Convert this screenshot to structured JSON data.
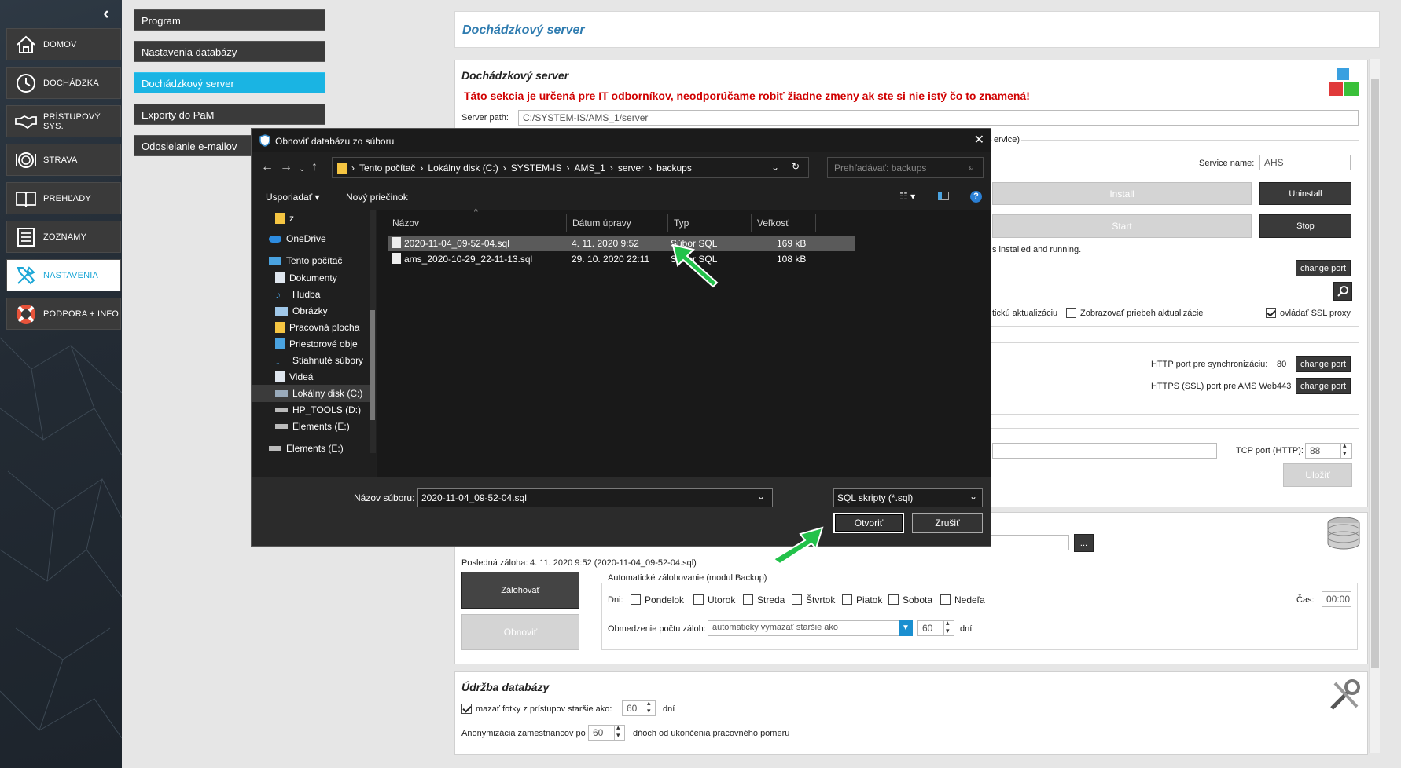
{
  "sidebar": {
    "items": [
      {
        "label": "DOMOV",
        "icon": "home-icon"
      },
      {
        "label": "DOCHÁDZKA",
        "icon": "clock-icon"
      },
      {
        "label": "PRÍSTUPOVÝ SYS.",
        "icon": "handshake-icon"
      },
      {
        "label": "STRAVA",
        "icon": "plate-icon"
      },
      {
        "label": "PREHĽADY",
        "icon": "book-icon"
      },
      {
        "label": "ZOZNAMY",
        "icon": "list-icon"
      },
      {
        "label": "NASTAVENIA",
        "icon": "tools-icon"
      },
      {
        "label": "PODPORA + INFO",
        "icon": "lifebuoy-icon"
      }
    ],
    "active": "NASTAVENIA"
  },
  "submenu": {
    "items": [
      "Program",
      "Nastavenia databázy",
      "Dochádzkový server",
      "Exporty do PaM",
      "Odosielanie e-mailov"
    ],
    "active": "Dochádzkový server"
  },
  "page": {
    "title": "Dochádzkový server"
  },
  "server_section": {
    "title": "Dochádzkový server",
    "warning": "Táto sekcia je určená pre IT odborníkov, neodporúčame robiť žiadne zmeny ak ste si nie istý čo to znamená!",
    "server_path_label": "Server path:",
    "server_path_value": "C:/SYSTEM-IS/AMS_1/server",
    "service_box_title_fragment": "ervice)",
    "service_name_label": "Service name:",
    "service_name_value": "AHS",
    "install_label": "Install",
    "uninstall_label": "Uninstall",
    "start_label": "Start",
    "stop_label": "Stop",
    "status_fragment": "s installed and running.",
    "change_port_label": "change port",
    "auto_update_fragment": "tickú aktualizáciu",
    "show_update_progress_label": "Zobrazovať priebeh aktualizácie",
    "ssl_proxy_label": "ovládať SSL proxy",
    "http_port_label": "HTTP port pre synchronizáciu:",
    "http_port_value": "80",
    "https_port_label": "HTTPS (SSL) port pre AMS Web:",
    "https_port_value": "443",
    "tcp_port_label": "TCP port (HTTP):",
    "tcp_port_value": "88",
    "save_label": "Uložiť"
  },
  "backup_section": {
    "last_backup_label": "Posledná záloha:",
    "last_backup_value": "4. 11. 2020 9:52 (2020-11-04_09-52-04.sql)",
    "backup_button": "Zálohovať",
    "restore_button": "Obnoviť",
    "browse_button": "...",
    "auto_backup_title": "Automatické zálohovanie (modul Backup)",
    "days_label": "Dni:",
    "days": [
      "Pondelok",
      "Utorok",
      "Streda",
      "Štvrtok",
      "Piatok",
      "Sobota",
      "Nedeľa"
    ],
    "time_label": "Čas:",
    "time_value": "00:00",
    "limit_label": "Obmedzenie počtu záloh:",
    "limit_option": "automaticky vymazať staršie ako",
    "limit_days_value": "60",
    "limit_days_unit": "dní"
  },
  "maintenance_section": {
    "title": "Údržba databázy",
    "delete_photos_label": "mazať fotky z prístupov staršie ako:",
    "delete_photos_value": "60",
    "delete_photos_unit": "dní",
    "anonymize_label": "Anonymizácia zamestnancov po",
    "anonymize_value": "60",
    "anonymize_unit": "dňoch od ukončenia pracovného pomeru"
  },
  "dialog": {
    "title": "Obnoviť databázu zo súboru",
    "breadcrumb": [
      "Tento počítač",
      "Lokálny disk (C:)",
      "SYSTEM-IS",
      "AMS_1",
      "server",
      "backups"
    ],
    "search_placeholder": "Prehľadávať: backups",
    "organize_label": "Usporiadať",
    "new_folder_label": "Nový priečinok",
    "tree": [
      {
        "label": "z",
        "icon": "folder-icon"
      },
      {
        "label": "OneDrive",
        "icon": "cloud-icon"
      },
      {
        "label": "Tento počítač",
        "icon": "computer-icon"
      },
      {
        "label": "Dokumenty",
        "icon": "documents-icon"
      },
      {
        "label": "Hudba",
        "icon": "music-icon"
      },
      {
        "label": "Obrázky",
        "icon": "pictures-icon"
      },
      {
        "label": "Pracovná plocha",
        "icon": "desktop-icon"
      },
      {
        "label": "Priestorové obje",
        "icon": "3d-objects-icon"
      },
      {
        "label": "Stiahnuté súbory",
        "icon": "downloads-icon"
      },
      {
        "label": "Videá",
        "icon": "videos-icon"
      },
      {
        "label": "Lokálny disk (C:)",
        "icon": "drive-icon"
      },
      {
        "label": "HP_TOOLS (D:)",
        "icon": "drive-icon"
      },
      {
        "label": "Elements (E:)",
        "icon": "drive-icon"
      },
      {
        "label": "Elements (E:)",
        "icon": "drive-icon"
      }
    ],
    "columns": [
      "Názov",
      "Dátum úpravy",
      "Typ",
      "Veľkosť"
    ],
    "files": [
      {
        "name": "2020-11-04_09-52-04.sql",
        "date": "4. 11. 2020 9:52",
        "type": "Súbor SQL",
        "size": "169 kB"
      },
      {
        "name": "ams_2020-10-29_22-11-13.sql",
        "date": "29. 10. 2020 22:11",
        "type": "Súbor SQL",
        "size": "108 kB"
      }
    ],
    "filename_label": "Názov súboru:",
    "filename_value": "2020-11-04_09-52-04.sql",
    "filter_value": "SQL skripty (*.sql)",
    "open_button": "Otvoriť",
    "cancel_button": "Zrušiť"
  },
  "colors": {
    "accent": "#1ab4e3",
    "warning": "#d00000",
    "arrow": "#22c24a"
  }
}
